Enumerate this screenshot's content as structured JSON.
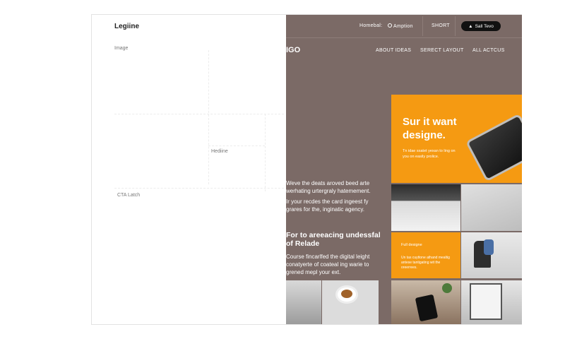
{
  "left": {
    "logo": "Legiine",
    "placeholders": {
      "image": "Image",
      "headline": "Hediine",
      "cta": "CTA Latch"
    }
  },
  "right": {
    "topnav": {
      "item1": "Homebal:",
      "item2": "Amption",
      "item3": "SHORT",
      "sale_button": "Sall Tevo"
    },
    "brand": "IGO",
    "nav": [
      "ABOUT IDEAS",
      "SERECT LAYOUT",
      "ALL ACTCUS"
    ],
    "hero": {
      "title": "Sur it want designe.",
      "subtitle": "Tn idae sxatet yexan to ling on you on easily prolice."
    },
    "body": {
      "p1": "Weve the deats aroved beed arte werhating urtergraly hatemement.",
      "p2": "Ir your recdes the card ingeest fy grares for the, inginatic agency.",
      "heading": "For to areeacing undessfal of Relade",
      "p3": "Course fincarlfed the digital leight conatyerte of coateal ing warie to grened mepl your ext."
    },
    "card": {
      "title": "Full designe",
      "text": "Un tas cuyttone athand mealtig antese tantigating wit the oreerrees."
    }
  },
  "colors": {
    "panel": "#7b6a66",
    "accent": "#f59a12"
  }
}
